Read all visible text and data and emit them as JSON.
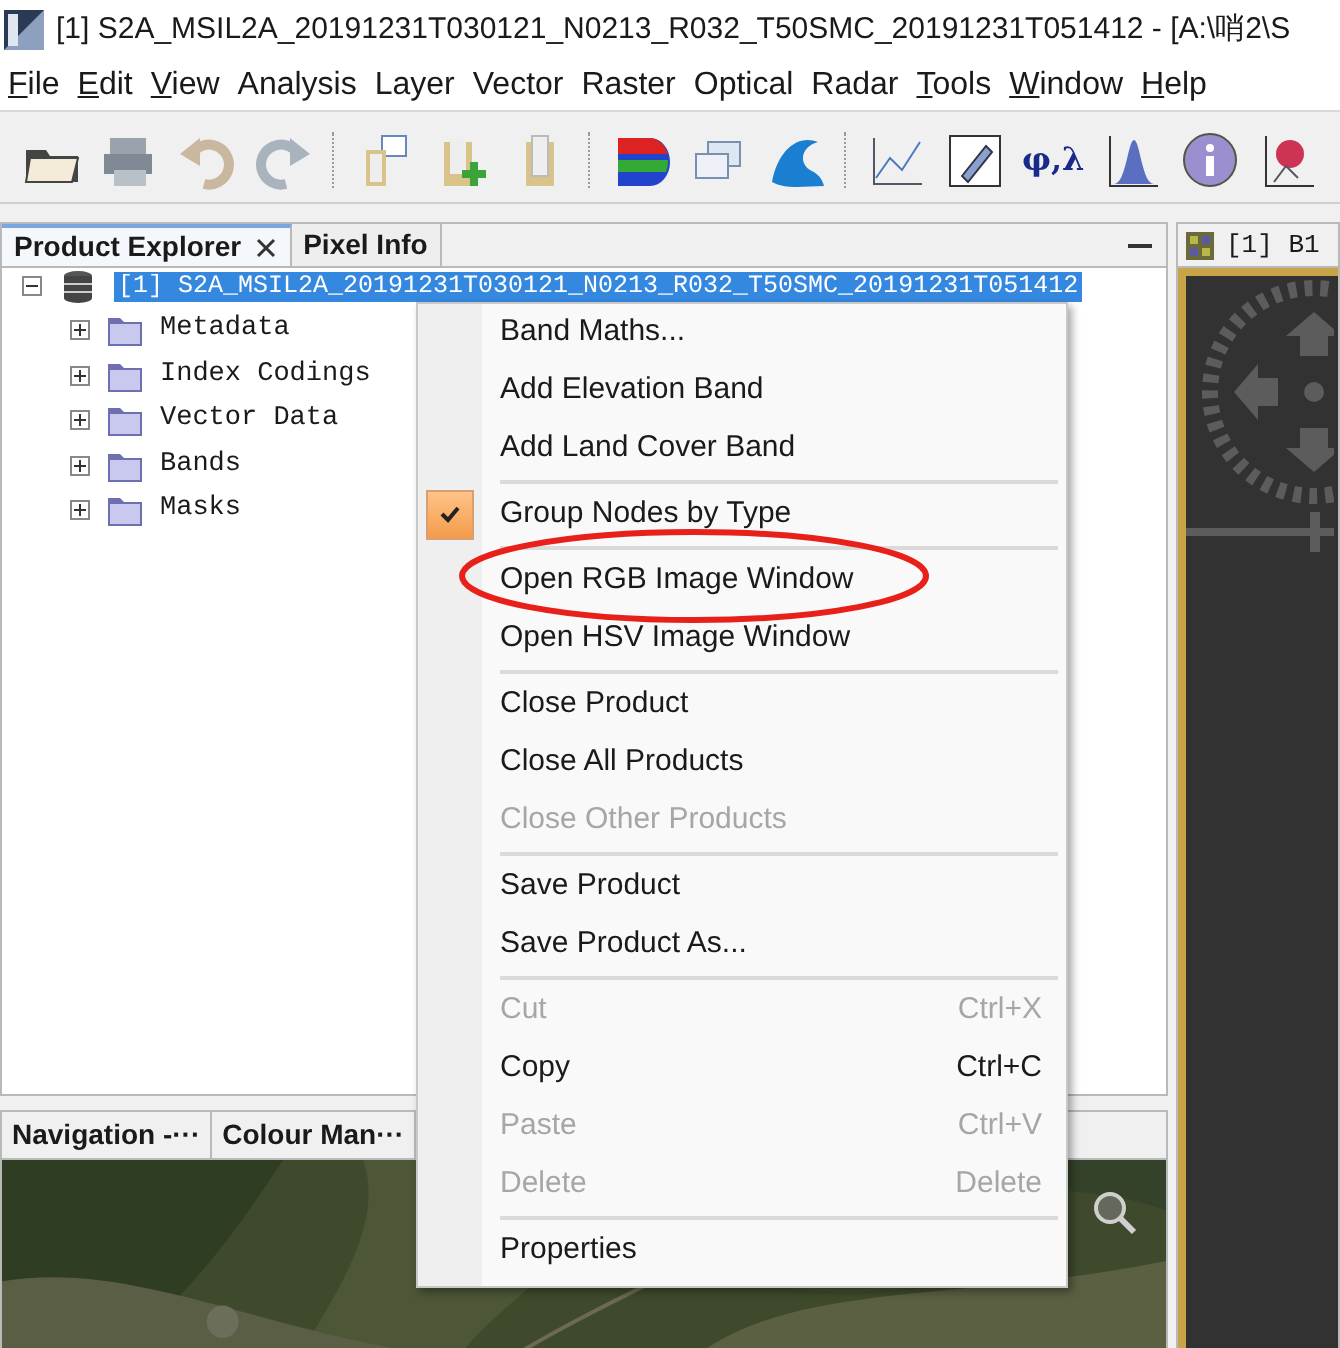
{
  "window": {
    "title": "[1] S2A_MSIL2A_20191231T030121_N0213_R032_T50SMC_20191231T051412 - [A:\\哨2\\S"
  },
  "menu_bar": [
    {
      "label": "File",
      "mnemonic": true
    },
    {
      "label": "Edit",
      "mnemonic": true
    },
    {
      "label": "View",
      "mnemonic": true
    },
    {
      "label": "Analysis",
      "mnemonic": false
    },
    {
      "label": "Layer",
      "mnemonic": false
    },
    {
      "label": "Vector",
      "mnemonic": false
    },
    {
      "label": "Raster",
      "mnemonic": false
    },
    {
      "label": "Optical",
      "mnemonic": false
    },
    {
      "label": "Radar",
      "mnemonic": false
    },
    {
      "label": "Tools",
      "mnemonic": true
    },
    {
      "label": "Window",
      "mnemonic": true
    },
    {
      "label": "Help",
      "mnemonic": true
    }
  ],
  "toolbar": {
    "geo_coding_label": "φ,λ"
  },
  "product_explorer": {
    "tabs": [
      {
        "label": "Product Explorer",
        "selected": true,
        "closable": true
      },
      {
        "label": "Pixel Info",
        "selected": false,
        "closable": false
      }
    ],
    "tree": [
      {
        "label": "[1] S2A_MSIL2A_20191231T030121_N0213_R032_T50SMC_20191231T051412",
        "selected": true,
        "expanded": true,
        "children": [
          {
            "label": "Metadata",
            "expanded": false
          },
          {
            "label": "Index Codings",
            "expanded": false
          },
          {
            "label": "Vector Data",
            "expanded": false
          },
          {
            "label": "Bands",
            "expanded": false
          },
          {
            "label": "Masks",
            "expanded": false
          }
        ]
      }
    ]
  },
  "image_view": {
    "tab": "[1] B1"
  },
  "bottom_panel": {
    "tabs": [
      {
        "label": "Navigation -···"
      },
      {
        "label": "Colour Man···"
      }
    ]
  },
  "context_menu": {
    "items": [
      {
        "kind": "item",
        "label": "Band Maths...",
        "disabled": false
      },
      {
        "kind": "item",
        "label": "Add Elevation Band",
        "disabled": false
      },
      {
        "kind": "item",
        "label": "Add Land Cover Band",
        "disabled": false
      },
      {
        "kind": "separator"
      },
      {
        "kind": "check",
        "label": "Group Nodes by Type",
        "checked": true,
        "disabled": false
      },
      {
        "kind": "separator"
      },
      {
        "kind": "item",
        "label": "Open RGB Image Window",
        "disabled": false
      },
      {
        "kind": "item",
        "label": "Open HSV Image Window",
        "disabled": false
      },
      {
        "kind": "separator"
      },
      {
        "kind": "item",
        "label": "Close Product",
        "disabled": false
      },
      {
        "kind": "item",
        "label": "Close All Products",
        "disabled": false
      },
      {
        "kind": "item",
        "label": "Close Other Products",
        "disabled": true
      },
      {
        "kind": "separator"
      },
      {
        "kind": "item",
        "label": "Save Product",
        "disabled": false
      },
      {
        "kind": "item",
        "label": "Save Product As...",
        "disabled": false
      },
      {
        "kind": "separator"
      },
      {
        "kind": "item",
        "label": "Cut",
        "shortcut": "Ctrl+X",
        "disabled": true
      },
      {
        "kind": "item",
        "label": "Copy",
        "shortcut": "Ctrl+C",
        "disabled": false
      },
      {
        "kind": "item",
        "label": "Paste",
        "shortcut": "Ctrl+V",
        "disabled": true
      },
      {
        "kind": "item",
        "label": "Delete",
        "shortcut": "Delete",
        "disabled": true
      },
      {
        "kind": "separator"
      },
      {
        "kind": "item",
        "label": "Properties",
        "disabled": false
      }
    ]
  }
}
